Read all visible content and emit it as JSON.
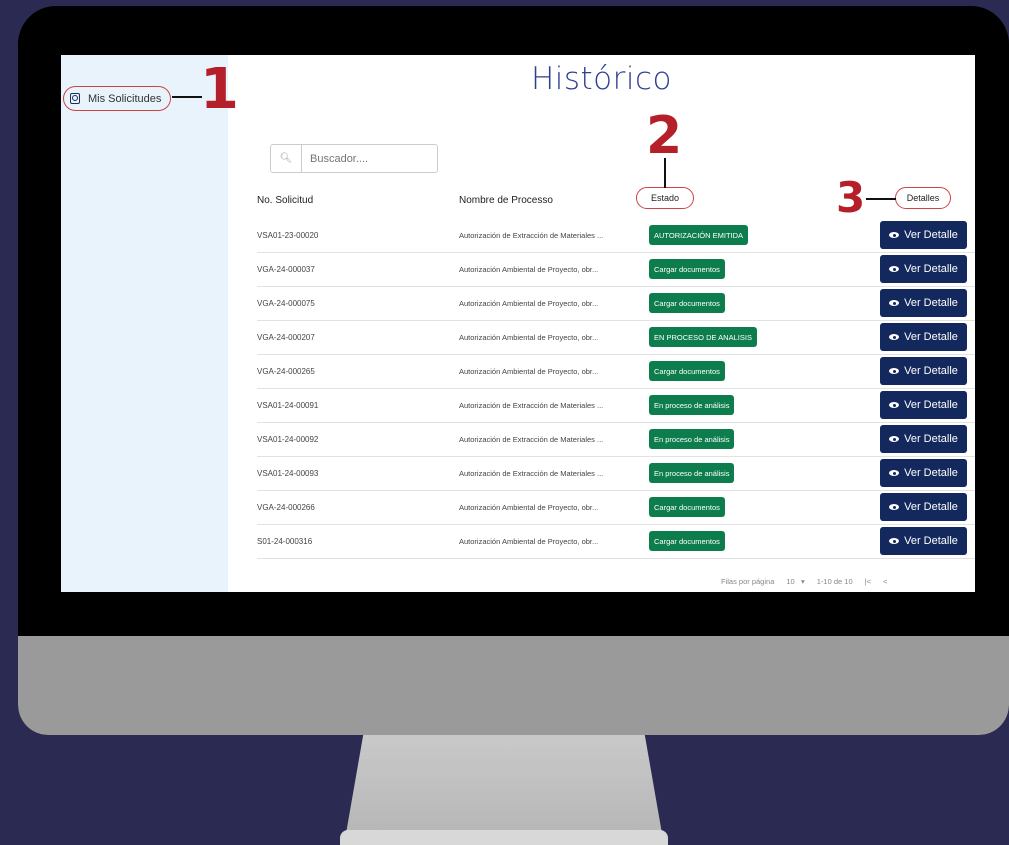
{
  "page": {
    "title": "Histórico"
  },
  "sidebar": {
    "items": [
      {
        "label": "Mis Solicitudes"
      }
    ]
  },
  "search": {
    "placeholder": "Buscador...."
  },
  "table": {
    "headers": {
      "id": "No. Solicitud",
      "name": "Nombre de Processo",
      "status": "Estado",
      "details": "Detalles"
    },
    "button_label": "Ver Detalle",
    "rows": [
      {
        "id": "VSA01-23-00020",
        "name": "Autorización de Extracción de Materiales ...",
        "status": "AUTORIZACIÓN EMITIDA"
      },
      {
        "id": "VGA-24-000037",
        "name": "Autorización Ambiental de Proyecto, obr...",
        "status": "Cargar documentos"
      },
      {
        "id": "VGA-24-000075",
        "name": "Autorización Ambiental de Proyecto, obr...",
        "status": "Cargar documentos"
      },
      {
        "id": "VGA-24-000207",
        "name": "Autorización Ambiental de Proyecto, obr...",
        "status": "EN PROCESO DE ANALISIS"
      },
      {
        "id": "VGA-24-000265",
        "name": "Autorización Ambiental de Proyecto, obr...",
        "status": "Cargar documentos"
      },
      {
        "id": "VSA01-24-00091",
        "name": "Autorización de Extracción de Materiales ...",
        "status": "En proceso de análisis"
      },
      {
        "id": "VSA01-24-00092",
        "name": "Autorización de Extracción de Materiales ...",
        "status": "En proceso de análisis"
      },
      {
        "id": "VSA01-24-00093",
        "name": "Autorización de Extracción de Materiales ...",
        "status": "En proceso de análisis"
      },
      {
        "id": "VGA-24-000266",
        "name": "Autorización Ambiental de Proyecto, obr...",
        "status": "Cargar documentos"
      },
      {
        "id": "S01-24-000316",
        "name": "Autorización Ambiental de Proyecto, obr...",
        "status": "Cargar documentos"
      }
    ]
  },
  "pagination": {
    "rows_label": "Filas por página",
    "rows_value": "10",
    "range": "1-10 de 10"
  },
  "annotations": {
    "one": "1",
    "two": "2",
    "three": "3"
  },
  "colors": {
    "badge": "#0e7d4e",
    "button": "#13285c",
    "title": "#2f3f8f",
    "annotation": "#b51f2a"
  }
}
